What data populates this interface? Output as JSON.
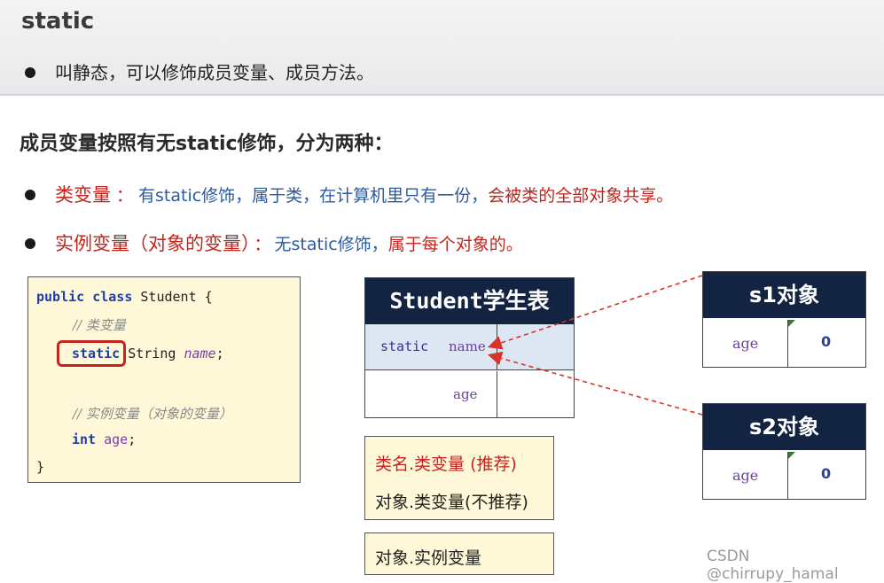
{
  "header": {
    "title": "static",
    "bullet": "叫静态，可以修饰成员变量、成员方法。"
  },
  "section": {
    "heading": "成员变量按照有无static修饰，分为两种："
  },
  "bullets": [
    {
      "term": "类变量",
      "sep": "：",
      "desc_blue": "有static修饰，属于类，在计算机里只有一份，",
      "desc_red": "会被类的全部对象共享。"
    },
    {
      "term": "实例变量（对象的变量）",
      "sep": "：",
      "desc_blue": "无static修饰，",
      "desc_red": "属于每个对象的。"
    }
  ],
  "code": {
    "line1_kw": "public class",
    "line1_rest": " Student {",
    "line2_comment": "// 类变量",
    "line3_kw": "static",
    "line3_type": "String ",
    "line3_field": "name",
    "line3_end": ";",
    "line4_comment": "// 实例变量（对象的变量）",
    "line5_kw": "int",
    "line5_field": "age",
    "line5_end": ";",
    "line6": "}"
  },
  "student_table": {
    "title": "Student学生表",
    "row1_static": "static",
    "row1_name": "name",
    "row2_field": "age"
  },
  "s1_table": {
    "title": "s1对象",
    "field": "age",
    "value": "0"
  },
  "s2_table": {
    "title": "s2对象",
    "field": "age",
    "value": "0"
  },
  "access_box": {
    "recommended": "类名.类变量 (推荐)",
    "not_recommended": "对象.类变量(不推荐)"
  },
  "instance_box": {
    "label": "对象.实例变量"
  },
  "watermark": "CSDN @chirrupy_hamal",
  "colors": {
    "red": "#c0261f",
    "blue": "#2c5aa0",
    "navy": "#132443",
    "note_bg": "#fff8d8"
  }
}
